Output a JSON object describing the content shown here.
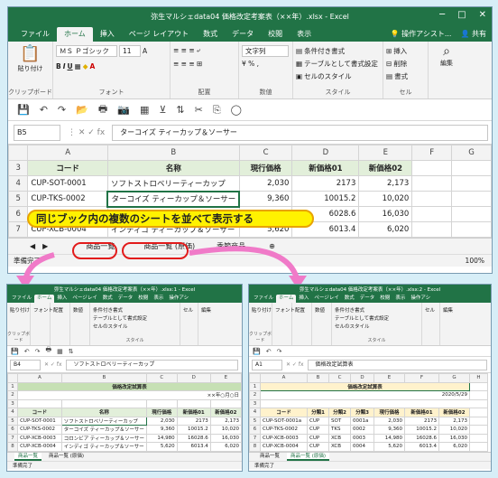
{
  "main": {
    "title": "弥生マルシェdata04  価格改定考案表（××年）.xlsx  -  Excel",
    "tabs": [
      "ファイル",
      "ホーム",
      "挿入",
      "ページ レイアウト",
      "数式",
      "データ",
      "校閲",
      "表示"
    ],
    "tell_me": "操作アシスト...",
    "share": "共有",
    "ribbon": {
      "paste": "貼り付け",
      "clipboard": "クリップボード",
      "font_name": "ＭＳ Ｐゴシック",
      "font_size": "11",
      "font_group": "フォント",
      "align_group": "配置",
      "num_format": "文字列",
      "num_group": "数値",
      "cond_format": "条件付き書式",
      "table_format": "テーブルとして書式設定",
      "cell_styles": "セルのスタイル",
      "style_group": "スタイル",
      "insert": "挿入",
      "delete": "削除",
      "format": "書式",
      "cell_group": "セル",
      "edit": "編集"
    },
    "name_box": "B5",
    "formula": "ターコイズ ティーカップ＆ソーサー",
    "columns": [
      "",
      "A",
      "B",
      "C",
      "D",
      "E",
      "F",
      "G"
    ],
    "rows": [
      {
        "n": "3",
        "a": "コード",
        "b": "名称",
        "c": "現行価格",
        "d": "新価格01",
        "e": "新価格02"
      },
      {
        "n": "4",
        "a": "CUP-SOT-0001",
        "b": "ソフトストロベリーティーカップ",
        "c": "2,030",
        "d": "2173",
        "e": "2,173"
      },
      {
        "n": "5",
        "a": "CUP-TKS-0002",
        "b": "ターコイズ ティーカップ＆ソーサー",
        "c": "9,360",
        "d": "10015.2",
        "e": "10,020"
      },
      {
        "n": "6",
        "a": "",
        "b": "",
        "c": "",
        "d": "6028.6",
        "e": "16,030"
      },
      {
        "n": "7",
        "a": "CUP-XCB-0004",
        "b": "インディゴ ティーカップ＆ソーサー",
        "c": "5,620",
        "d": "6013.4",
        "e": "6,020"
      }
    ],
    "sheets": [
      "商品一覧",
      "商品一覧 (原価)",
      "季節商品"
    ],
    "status": "準備完了",
    "zoom": "100%",
    "callout": "同じブック内の複数のシートを並べて表示する"
  },
  "left": {
    "title": "弥生マルシェdata04  価格改定考案表（××年）.xlsx:1 - Excel",
    "tabs": [
      "ファイル",
      "ホーム",
      "挿入",
      "ページレイ",
      "数式",
      "データ",
      "校閲",
      "表示"
    ],
    "tell_me": "操作アシ",
    "paste": "貼り付け",
    "font": "フォント",
    "align": "配置",
    "number": "数値",
    "cond": "条件付き書式",
    "tablefmt": "テーブルとして書式設定",
    "cellstyle": "セルのスタイル",
    "cell": "セル",
    "edit": "編集",
    "clip": "クリップボード",
    "style": "スタイル",
    "name_box": "B4",
    "formula": "ソフトストロベリーティーカップ",
    "columns": [
      "",
      "A",
      "B",
      "C",
      "D",
      "E"
    ],
    "banner": "価格改定試算表",
    "date": "××年○月○日",
    "rows": [
      {
        "n": "3",
        "a": "",
        "b": "",
        "c": "",
        "d": "",
        "e": ""
      },
      {
        "n": "4",
        "a": "コード",
        "b": "名称",
        "c": "現行価格",
        "d": "新価格01",
        "e": "新価格02"
      },
      {
        "n": "5",
        "a": "CUP-SOT-0001",
        "b": "ソフトストロベリーティーカップ",
        "c": "2,030",
        "d": "2173",
        "e": "2,173"
      },
      {
        "n": "6",
        "a": "CUP-TKS-0002",
        "b": "ターコイズ ティーカップ＆ソーサー",
        "c": "9,360",
        "d": "10015.2",
        "e": "10,020"
      },
      {
        "n": "7",
        "a": "CUP-XCB-0003",
        "b": "コロンビア ティーカップ＆ソーサー",
        "c": "14,980",
        "d": "16028.6",
        "e": "16,030"
      },
      {
        "n": "8",
        "a": "CUP-XCB-0004",
        "b": "インディゴ ティーカップ＆ソーサー",
        "c": "5,620",
        "d": "6013.4",
        "e": "6,020"
      }
    ],
    "sheets": [
      "商品一覧",
      "商品一覧 (原価)"
    ],
    "status": "準備完了"
  },
  "right": {
    "title": "弥生マルシェdata04  価格改定考案表（××年）.xlsx:2 - Excel",
    "tabs": [
      "ファイル",
      "ホーム",
      "挿入",
      "ページレイ",
      "数式",
      "データ",
      "校閲",
      "表示"
    ],
    "tell_me": "操作アシ",
    "name_box": "A1",
    "formula": "価格改定試算表",
    "columns": [
      "",
      "A",
      "B",
      "C",
      "D",
      "E",
      "F",
      "G",
      "H"
    ],
    "banner": "価格改定試算表",
    "date": "2020/5/29",
    "rows": [
      {
        "n": "4",
        "a": "コード",
        "b": "分類1",
        "c": "分類2",
        "d": "分類3",
        "e": "現行価格",
        "f": "新価格01",
        "g": "新価格02"
      },
      {
        "n": "5",
        "a": "CUP-SOT-0001a",
        "b": "CUP",
        "c": "SOT",
        "d": "0001a",
        "e": "2,030",
        "f": "2173",
        "g": "2,173"
      },
      {
        "n": "6",
        "a": "CUP-TKS-0002",
        "b": "CUP",
        "c": "TKS",
        "d": "0002",
        "e": "9,360",
        "f": "10015.2",
        "g": "10,020"
      },
      {
        "n": "7",
        "a": "CUP-XCB-0003",
        "b": "CUP",
        "c": "XCB",
        "d": "0003",
        "e": "14,980",
        "f": "16028.6",
        "g": "16,030"
      },
      {
        "n": "8",
        "a": "CUP-XCB-0004",
        "b": "CUP",
        "c": "XCB",
        "d": "0004",
        "e": "5,620",
        "f": "6013.4",
        "g": "6,020"
      }
    ],
    "sheets": [
      "商品一覧",
      "商品一覧 (原価)"
    ],
    "status": "準備完了"
  }
}
